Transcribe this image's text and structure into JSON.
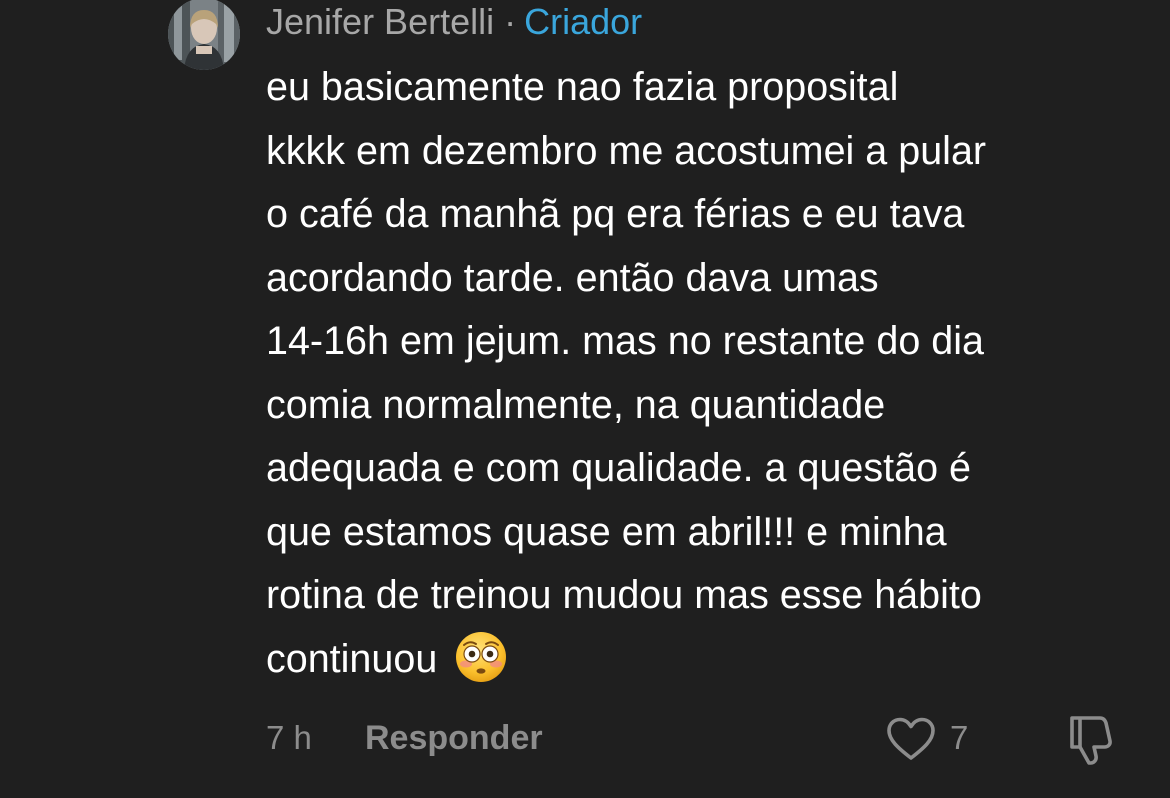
{
  "comment": {
    "author": "Jenifer Bertelli",
    "separator": "·",
    "badge": "Criador",
    "body_lines": [
      "eu basicamente nao fazia proposital",
      "kkkk em dezembro me acostumei a pular",
      "o café da manhã pq era férias e eu tava",
      "acordando tarde. então dava umas",
      "14-16h em jejum. mas no restante do dia",
      "comia normalmente, na quantidade",
      "adequada e com qualidade. a questão é",
      "que estamos quase em abril!!! e minha",
      "rotina de treinou mudou mas esse hábito",
      "continuou"
    ],
    "trailing_emoji": "flushed-face",
    "time_ago": "7 h",
    "reply_label": "Responder",
    "like_count": "7",
    "icons": {
      "like": "heart-outline-icon",
      "dislike": "thumbs-down-outline-icon"
    },
    "colors": {
      "background": "#1f1f1f",
      "author": "#a7a7a7",
      "badge": "#3aa6dc",
      "meta": "#8c8c8c",
      "body": "#ffffff"
    }
  }
}
